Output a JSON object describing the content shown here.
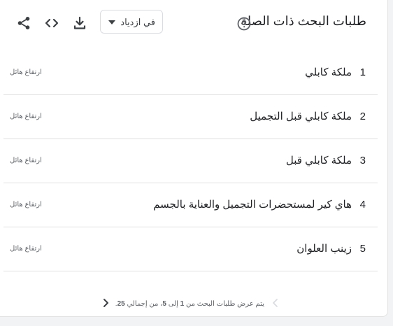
{
  "panel": {
    "title": "طلبات البحث ذات الصلة",
    "help_icon": "help-circle-icon",
    "filter": {
      "selected": "في ازدياد"
    },
    "icons": [
      "download-icon",
      "embed-code-icon",
      "share-icon"
    ]
  },
  "rows": [
    {
      "rank": "1",
      "query": "ملكة كابلي",
      "status": "ارتفاع هائل"
    },
    {
      "rank": "2",
      "query": "ملكة كابلي قبل التجميل",
      "status": "ارتفاع هائل"
    },
    {
      "rank": "3",
      "query": "ملكة كابلي قبل",
      "status": "ارتفاع هائل"
    },
    {
      "rank": "4",
      "query": "هاي كير لمستحضرات التجميل والعناية بالجسم",
      "status": "ارتفاع هائل"
    },
    {
      "rank": "5",
      "query": "زينب العلوان",
      "status": "ارتفاع هائل"
    }
  ],
  "pagination": {
    "text_before_start": "يتم عرض طلبات البحث من ",
    "start": "1",
    "text_before_end": " إلى ",
    "end": "5",
    "text_before_total": "، من إجمالي ",
    "total": "25",
    "text_after_total": "."
  },
  "colors": {
    "text": "#202124",
    "muted": "#5f6368",
    "divider": "#e0e0e0",
    "disabled": "#dadce0"
  }
}
